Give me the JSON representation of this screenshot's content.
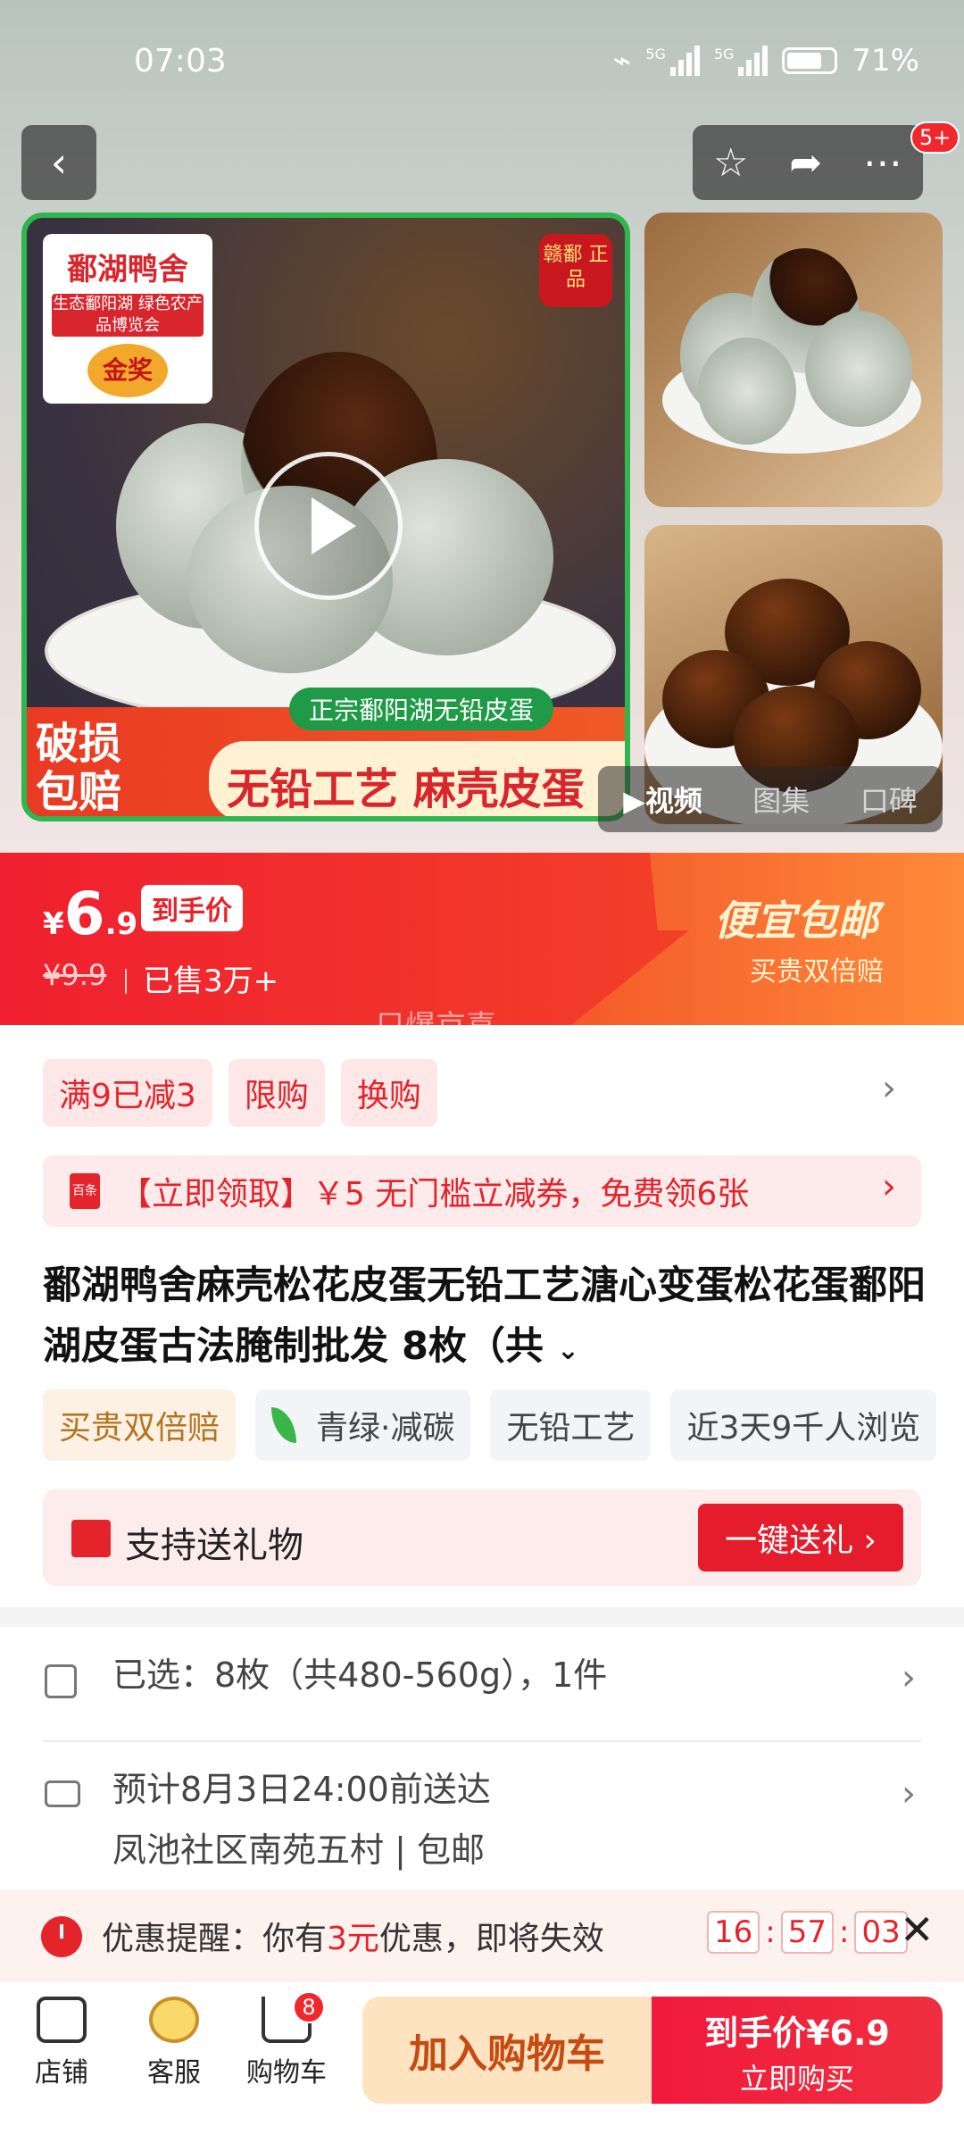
{
  "status_bar": {
    "time": "07:03",
    "net1": "5G",
    "net2": "5G",
    "battery": "71%"
  },
  "header": {
    "back_icon": "chevron-left-icon",
    "actions": [
      "star-icon",
      "share-icon",
      "more-icon"
    ],
    "message_badge": "5+"
  },
  "gallery": {
    "brand_name": "鄱湖鸭舍",
    "award_line": "生态鄱阳湖 绿色农产品博览会",
    "award": "金奖",
    "seal": "赣鄱 正品",
    "ribbon_left": "破损 包赔",
    "ribbon_tag": "正宗鄱阳湖无铅皮蛋",
    "ribbon_main": "无铅工艺 麻壳皮蛋",
    "tabs": [
      "▶视频",
      "图集",
      "口碑"
    ]
  },
  "price": {
    "currency": "¥",
    "integer": "6",
    "decimal": ".9",
    "after_label": "到手价",
    "original": "¥9.9",
    "sold": "已售3万+",
    "free_shipping": "便宜包邮",
    "guarantee": "买贵双倍赔",
    "watermark": "只爆京喜"
  },
  "promos": [
    "满9已减3",
    "限购",
    "换购"
  ],
  "coupon": {
    "icon": "百条",
    "text": "【立即领取】￥5 无门槛立减券，免费领6张"
  },
  "product": {
    "title": "鄱湖鸭舍麻壳松花皮蛋无铅工艺溏心变蛋松花蛋鄱阳湖皮蛋古法腌制批发 8枚（共",
    "tags": [
      "买贵双倍赔",
      "青绿·减碳",
      "无铅工艺",
      "近3天9千人浏览"
    ]
  },
  "gift": {
    "text": "支持送礼物",
    "button": "一键送礼 ›"
  },
  "selection": {
    "text": "已选：8枚（共480-560g），1件"
  },
  "delivery": {
    "line1": "预计8月3日24:00前送达",
    "line2": "凤池社区南苑五村 | 包邮"
  },
  "reminder": {
    "prefix": "优惠提醒：你有",
    "amount": "3元",
    "suffix": "优惠，即将失效",
    "h": "16",
    "m": "57",
    "s": "03"
  },
  "bottom": {
    "shop": "店铺",
    "service": "客服",
    "cart": "购物车",
    "cart_count": "8",
    "add_cart": "加入购物车",
    "buy_line1": "到手价¥6.9",
    "buy_line2": "立即购买"
  },
  "colors": {
    "accent": "#e4232b",
    "green_frame": "#2fb64f",
    "cart_button": "#fde3c0"
  }
}
